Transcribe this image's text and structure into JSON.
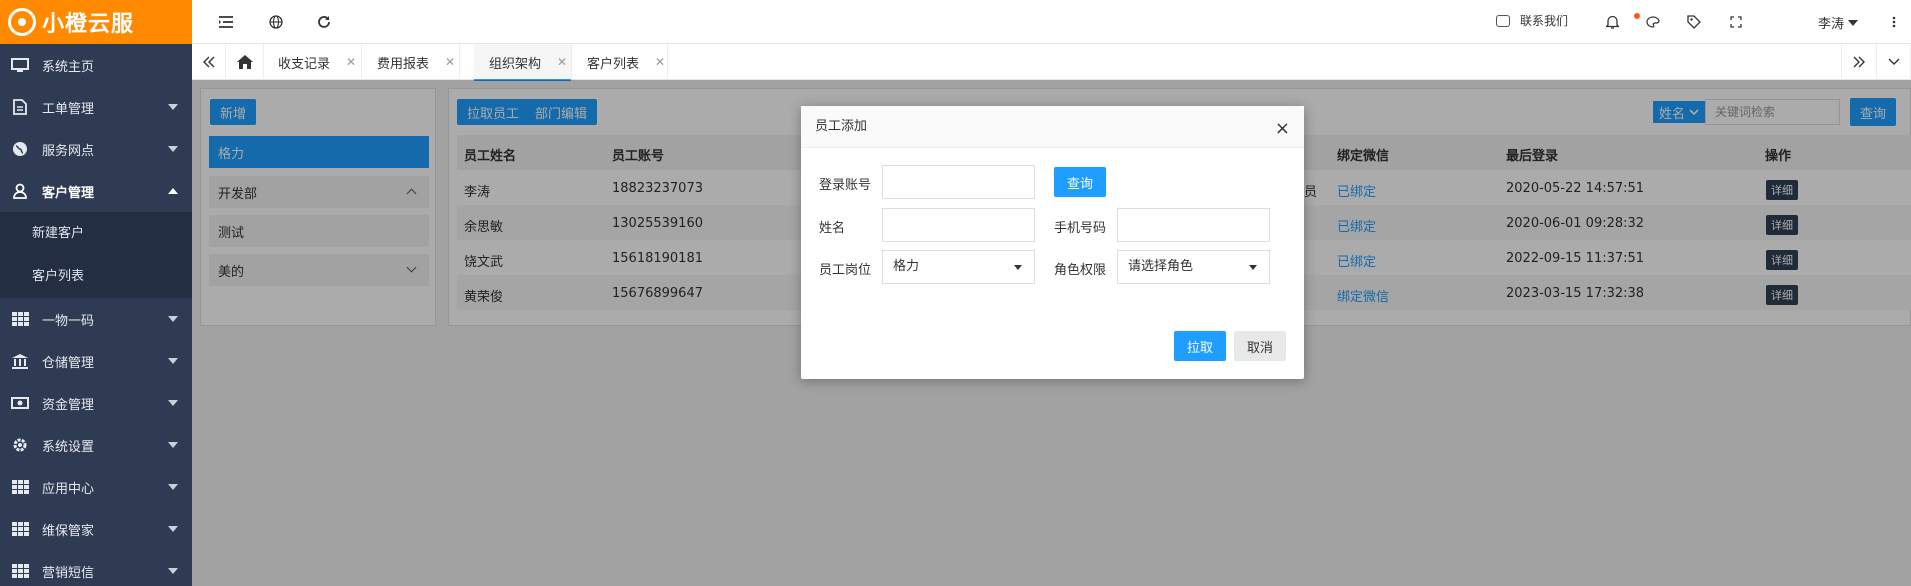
{
  "brand": {
    "name": "小橙云服"
  },
  "sidebar": {
    "items": [
      {
        "label": "系统主页",
        "icon": "monitor-icon"
      },
      {
        "label": "工单管理",
        "icon": "document-icon"
      },
      {
        "label": "服务网点",
        "icon": "globe-icon"
      },
      {
        "label": "客户管理",
        "icon": "user-icon"
      },
      {
        "label": "一物一码",
        "icon": "grid-icon"
      },
      {
        "label": "仓储管理",
        "icon": "bank-icon"
      },
      {
        "label": "资金管理",
        "icon": "money-icon"
      },
      {
        "label": "系统设置",
        "icon": "gear-icon"
      },
      {
        "label": "应用中心",
        "icon": "grid-icon"
      },
      {
        "label": "维保管家",
        "icon": "grid-icon"
      },
      {
        "label": "营销短信",
        "icon": "grid-icon"
      }
    ],
    "submenu": [
      "新建客户",
      "客户列表"
    ]
  },
  "topbar": {
    "contact": "联系我们",
    "user": "李涛"
  },
  "tabs": [
    "收支记录",
    "费用报表",
    "组织架构",
    "客户列表"
  ],
  "left": {
    "add": "新增",
    "depts": [
      "格力",
      "开发部",
      "测试",
      "美的"
    ]
  },
  "toolbar": {
    "pull": "拉取员工",
    "edit": "部门编辑",
    "search_field": "姓名",
    "search_placeholder": "关键词检索",
    "search_btn": "查询"
  },
  "table": {
    "headers": [
      "员工姓名",
      "员工账号",
      "绑定微信",
      "最后登录",
      "操作"
    ],
    "rows": [
      {
        "name": "李涛",
        "account": "18823237073",
        "frag": "员",
        "wechat": "已绑定",
        "last": "2020-05-22 14:57:51",
        "op": "详细"
      },
      {
        "name": "余思敏",
        "account": "13025539160",
        "frag": "",
        "wechat": "已绑定",
        "last": "2020-06-01 09:28:32",
        "op": "详细"
      },
      {
        "name": "饶文武",
        "account": "15618190181",
        "frag": "",
        "wechat": "已绑定",
        "last": "2022-09-15 11:37:51",
        "op": "详细"
      },
      {
        "name": "黄荣俊",
        "account": "15676899647",
        "frag": "",
        "wechat": "绑定微信",
        "last": "2023-03-15 17:32:38",
        "op": "详细"
      }
    ]
  },
  "modal": {
    "title": "员工添加",
    "close": "×",
    "login_label": "登录账号",
    "query": "查询",
    "name_label": "姓名",
    "phone_label": "手机号码",
    "post_label": "员工岗位",
    "post_value": "格力",
    "role_label": "角色权限",
    "role_value": "请选择角色",
    "submit": "拉取",
    "cancel": "取消"
  },
  "colors": {
    "brand": "#ff8a00",
    "sidebar": "#2f3b52",
    "primary": "#1e9fff",
    "badge": "#ff5722"
  }
}
